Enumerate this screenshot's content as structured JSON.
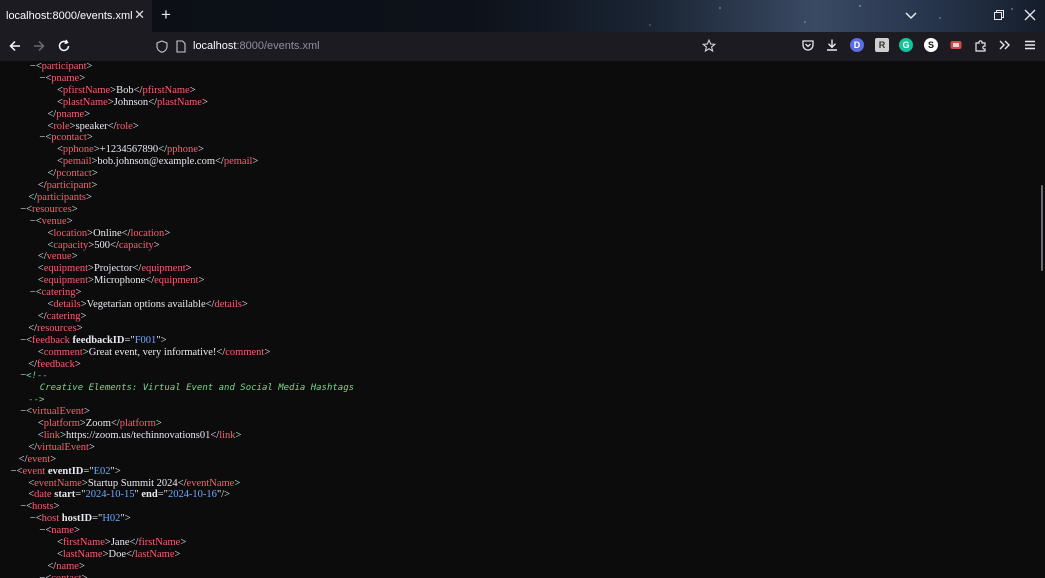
{
  "browser": {
    "tab_title": "localhost:8000/events.xml",
    "url_host": "localhost",
    "url_path": ":8000/events.xml"
  },
  "extensions": [
    {
      "name": "pocket-icon"
    },
    {
      "name": "downloads-icon"
    },
    {
      "letter": "D",
      "color": "#5b6ee1"
    },
    {
      "letter": "R",
      "color": "#cfcfcf"
    },
    {
      "letter": "G",
      "color": "#15c39a"
    },
    {
      "letter": "S",
      "color": "#ffffff"
    }
  ],
  "xml": [
    {
      "indent": 3,
      "toggle": true,
      "tag": "participant",
      "type": "open"
    },
    {
      "indent": 4,
      "toggle": true,
      "tag": "pname",
      "type": "open"
    },
    {
      "indent": 5,
      "tag": "pfirstName",
      "text": "Bob",
      "type": "leaf"
    },
    {
      "indent": 5,
      "tag": "plastName",
      "text": "Johnson",
      "type": "leaf"
    },
    {
      "indent": 4,
      "tag": "pname",
      "type": "close"
    },
    {
      "indent": 4,
      "tag": "role",
      "text": "speaker",
      "type": "leaf"
    },
    {
      "indent": 4,
      "toggle": true,
      "tag": "pcontact",
      "type": "open"
    },
    {
      "indent": 5,
      "tag": "pphone",
      "text": "+1234567890",
      "type": "leaf"
    },
    {
      "indent": 5,
      "tag": "pemail",
      "text": "bob.johnson@example.com",
      "type": "leaf"
    },
    {
      "indent": 4,
      "tag": "pcontact",
      "type": "close"
    },
    {
      "indent": 3,
      "tag": "participant",
      "type": "close"
    },
    {
      "indent": 2,
      "tag": "participants",
      "type": "close"
    },
    {
      "indent": 2,
      "toggle": true,
      "tag": "resources",
      "type": "open"
    },
    {
      "indent": 3,
      "toggle": true,
      "tag": "venue",
      "type": "open"
    },
    {
      "indent": 4,
      "tag": "location",
      "text": "Online",
      "type": "leaf"
    },
    {
      "indent": 4,
      "tag": "capacity",
      "text": "500",
      "type": "leaf"
    },
    {
      "indent": 3,
      "tag": "venue",
      "type": "close"
    },
    {
      "indent": 3,
      "tag": "equipment",
      "text": "Projector",
      "type": "leaf"
    },
    {
      "indent": 3,
      "tag": "equipment",
      "text": "Microphone",
      "type": "leaf"
    },
    {
      "indent": 3,
      "toggle": true,
      "tag": "catering",
      "type": "open"
    },
    {
      "indent": 4,
      "tag": "details",
      "text": "Vegetarian options available",
      "type": "leaf"
    },
    {
      "indent": 3,
      "tag": "catering",
      "type": "close"
    },
    {
      "indent": 2,
      "tag": "resources",
      "type": "close"
    },
    {
      "indent": 2,
      "toggle": true,
      "tag": "feedback",
      "attrs": [
        {
          "name": "feedbackID",
          "value": "F001"
        }
      ],
      "type": "open"
    },
    {
      "indent": 3,
      "tag": "comment",
      "text": "Great event, very informative!",
      "type": "leaf"
    },
    {
      "indent": 2,
      "tag": "feedback",
      "type": "close"
    },
    {
      "indent": 2,
      "toggle": true,
      "type": "comment-open",
      "text": "<!--"
    },
    {
      "indent": 3,
      "type": "comment-body",
      "text": "Creative Elements: Virtual Event and Social Media Hashtags"
    },
    {
      "indent": 2,
      "type": "comment-close",
      "text": "-->"
    },
    {
      "indent": 2,
      "toggle": true,
      "tag": "virtualEvent",
      "type": "open"
    },
    {
      "indent": 3,
      "tag": "platform",
      "text": "Zoom",
      "type": "leaf"
    },
    {
      "indent": 3,
      "tag": "link",
      "text": "https://zoom.us/techinnovations01",
      "type": "leaf"
    },
    {
      "indent": 2,
      "tag": "virtualEvent",
      "type": "close"
    },
    {
      "indent": 1,
      "tag": "event",
      "type": "close"
    },
    {
      "indent": 1,
      "toggle": true,
      "tag": "event",
      "attrs": [
        {
          "name": "eventID",
          "value": "E02"
        }
      ],
      "type": "open"
    },
    {
      "indent": 2,
      "tag": "eventName",
      "text": "Startup Summit 2024",
      "type": "leaf"
    },
    {
      "indent": 2,
      "tag": "date",
      "attrs": [
        {
          "name": "start",
          "value": "2024-10-15"
        },
        {
          "name": "end",
          "value": "2024-10-16"
        }
      ],
      "type": "empty"
    },
    {
      "indent": 2,
      "toggle": true,
      "tag": "hosts",
      "type": "open"
    },
    {
      "indent": 3,
      "toggle": true,
      "tag": "host",
      "attrs": [
        {
          "name": "hostID",
          "value": "H02"
        }
      ],
      "type": "open"
    },
    {
      "indent": 4,
      "toggle": true,
      "tag": "name",
      "type": "open"
    },
    {
      "indent": 5,
      "tag": "firstName",
      "text": "Jane",
      "type": "leaf"
    },
    {
      "indent": 5,
      "tag": "lastName",
      "text": "Doe",
      "type": "leaf"
    },
    {
      "indent": 4,
      "tag": "name",
      "type": "close"
    },
    {
      "indent": 4,
      "toggle": true,
      "tag": "contact",
      "type": "open"
    }
  ]
}
